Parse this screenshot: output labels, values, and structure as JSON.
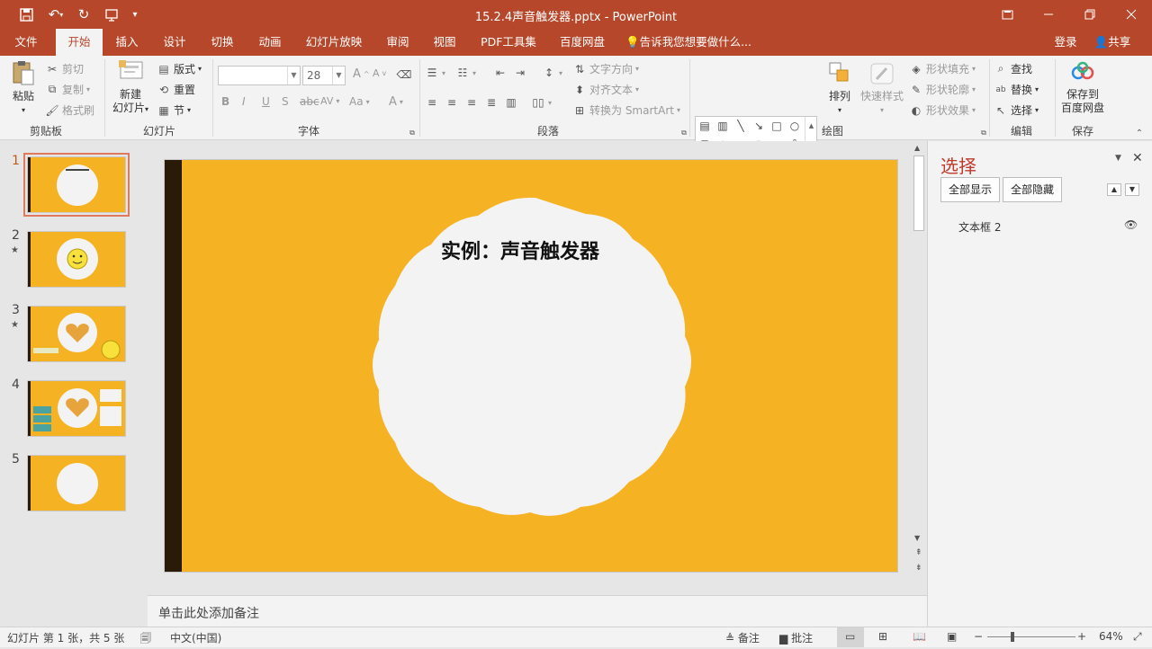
{
  "window": {
    "title": "15.2.4声音触发器.pptx - PowerPoint"
  },
  "menu": {
    "tabs": [
      "文件",
      "开始",
      "插入",
      "设计",
      "切换",
      "动画",
      "幻灯片放映",
      "审阅",
      "视图",
      "PDF工具集",
      "百度网盘"
    ],
    "tellme": "告诉我您想要做什么...",
    "login": "登录",
    "share": "共享"
  },
  "ribbon": {
    "clipboard": {
      "paste": "粘贴",
      "cut": "剪切",
      "copy": "复制",
      "format_painter": "格式刷",
      "label": "剪贴板"
    },
    "slides": {
      "new_slide_line1": "新建",
      "new_slide_line2": "幻灯片",
      "layout": "版式",
      "reset": "重置",
      "section": "节",
      "label": "幻灯片"
    },
    "font": {
      "name": "",
      "size": "28",
      "label": "字体",
      "bold": "B",
      "italic": "I",
      "underline": "U",
      "strike": "S",
      "spacing": "AV",
      "case": "Aa",
      "color": "A",
      "grow": "A",
      "shrink": "A"
    },
    "paragraph": {
      "text_direction": "文字方向",
      "align_text": "对齐文本",
      "convert_smartart": "转换为 SmartArt",
      "label": "段落"
    },
    "drawing": {
      "arrange": "排列",
      "quick_styles": "快速样式",
      "shape_fill": "形状填充",
      "shape_outline": "形状轮廓",
      "shape_effects": "形状效果",
      "label": "绘图"
    },
    "editing": {
      "find": "查找",
      "replace": "替换",
      "select": "选择",
      "label": "编辑"
    },
    "save": {
      "line1": "保存到",
      "line2": "百度网盘",
      "label": "保存"
    }
  },
  "thumbnails": [
    {
      "num": "1",
      "star": "",
      "selected": true
    },
    {
      "num": "2",
      "star": "★",
      "selected": false
    },
    {
      "num": "3",
      "star": "★",
      "selected": false
    },
    {
      "num": "4",
      "star": "",
      "selected": false
    },
    {
      "num": "5",
      "star": "",
      "selected": false
    }
  ],
  "slide": {
    "title": "实例：声音触发器"
  },
  "notes": {
    "placeholder": "单击此处添加备注"
  },
  "selection_pane": {
    "title": "选择",
    "show_all": "全部显示",
    "hide_all": "全部隐藏",
    "items": [
      "文本框 2"
    ]
  },
  "status": {
    "slide_info": "幻灯片 第 1 张，共 5 张",
    "language": "中文(中国)",
    "notes": "备注",
    "comments": "批注",
    "zoom": "64%"
  },
  "colors": {
    "accent": "#b7472a",
    "slide_bg": "#f5b223",
    "slide_bar": "#2a1a08",
    "badge": "#f3f3f3",
    "pane_title": "#c0392b"
  },
  "icons": [
    "save-icon",
    "undo-icon",
    "redo-icon",
    "present-icon",
    "customize-icon",
    "restore-icon",
    "minimize-icon",
    "maximize-icon",
    "close-icon",
    "lightbulb-icon",
    "user-icon",
    "eye-icon"
  ]
}
